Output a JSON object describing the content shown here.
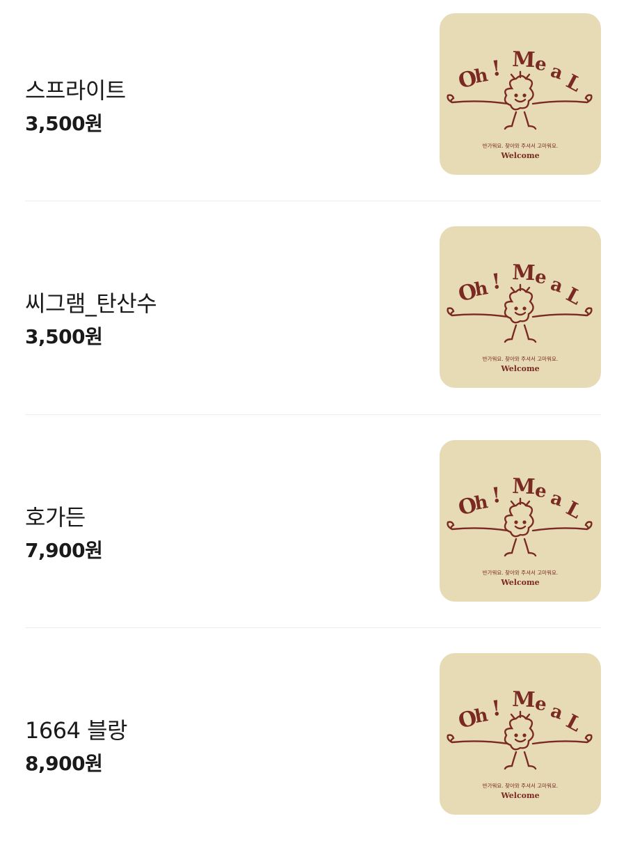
{
  "menu": {
    "items": [
      {
        "name": "스프라이트",
        "price": "3,500원",
        "image": {
          "logo_text": "Oh! Meal",
          "tagline": "반가워요. 찾아와 주셔서 고마워요.",
          "welcome": "Welcome"
        }
      },
      {
        "name": "씨그램_탄산수",
        "price": "3,500원",
        "image": {
          "logo_text": "Oh! Meal",
          "tagline": "반가워요. 찾아와 주셔서 고마워요.",
          "welcome": "Welcome"
        }
      },
      {
        "name": "호가든",
        "price": "7,900원",
        "image": {
          "logo_text": "Oh! Meal",
          "tagline": "반가워요. 찾아와 주셔서 고마워요.",
          "welcome": "Welcome"
        }
      },
      {
        "name": "1664 블랑",
        "price": "8,900원",
        "image": {
          "logo_text": "Oh! Meal",
          "tagline": "반가워요. 찾아와 주셔서 고마워요.",
          "welcome": "Welcome"
        }
      }
    ]
  },
  "colors": {
    "thumbnail_bg": "#e6dbb5",
    "logo_brown": "#7a2a22",
    "divider": "#ececec",
    "text": "#1a1a1a"
  }
}
